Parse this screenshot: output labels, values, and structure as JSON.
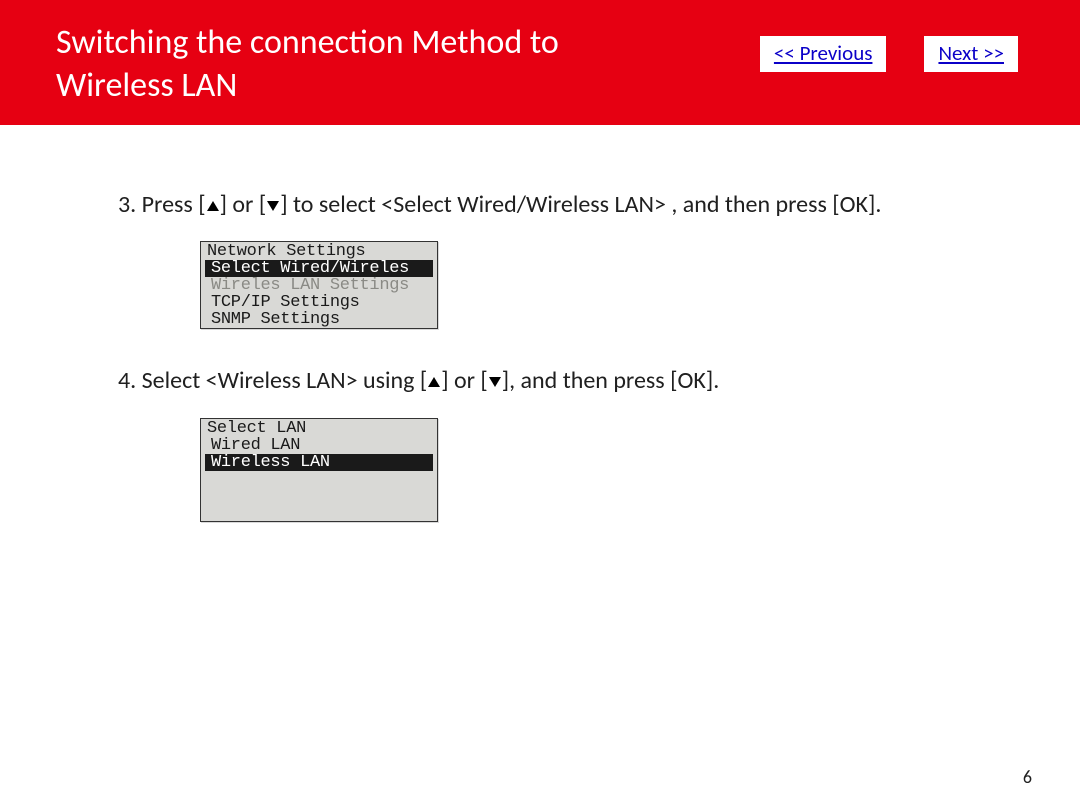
{
  "header": {
    "title": "Switching the connection Method to Wireless LAN"
  },
  "nav": {
    "prev": "<< Previous",
    "next": "Next >>"
  },
  "steps": {
    "s3_a": "3. Press [",
    "s3_b": "] or [",
    "s3_c": "] to select  <Select Wired/Wireless LAN> , and then press [OK].",
    "s4_a": "4. Select <Wireless LAN> using [",
    "s4_b": "] or [",
    "s4_c": "], and then press [OK]."
  },
  "lcd1": {
    "title": "Network Settings",
    "rows": [
      {
        "text": "Select Wired/Wireles",
        "sel": true,
        "disabled": false
      },
      {
        "text": "Wireles LAN Settings",
        "sel": false,
        "disabled": true
      },
      {
        "text": "TCP/IP Settings",
        "sel": false,
        "disabled": false
      },
      {
        "text": "SNMP Settings",
        "sel": false,
        "disabled": false
      }
    ]
  },
  "lcd2": {
    "title": "Select LAN",
    "rows": [
      {
        "text": "Wired LAN",
        "sel": false
      },
      {
        "text": "Wireless LAN",
        "sel": true
      }
    ]
  },
  "page": "6"
}
